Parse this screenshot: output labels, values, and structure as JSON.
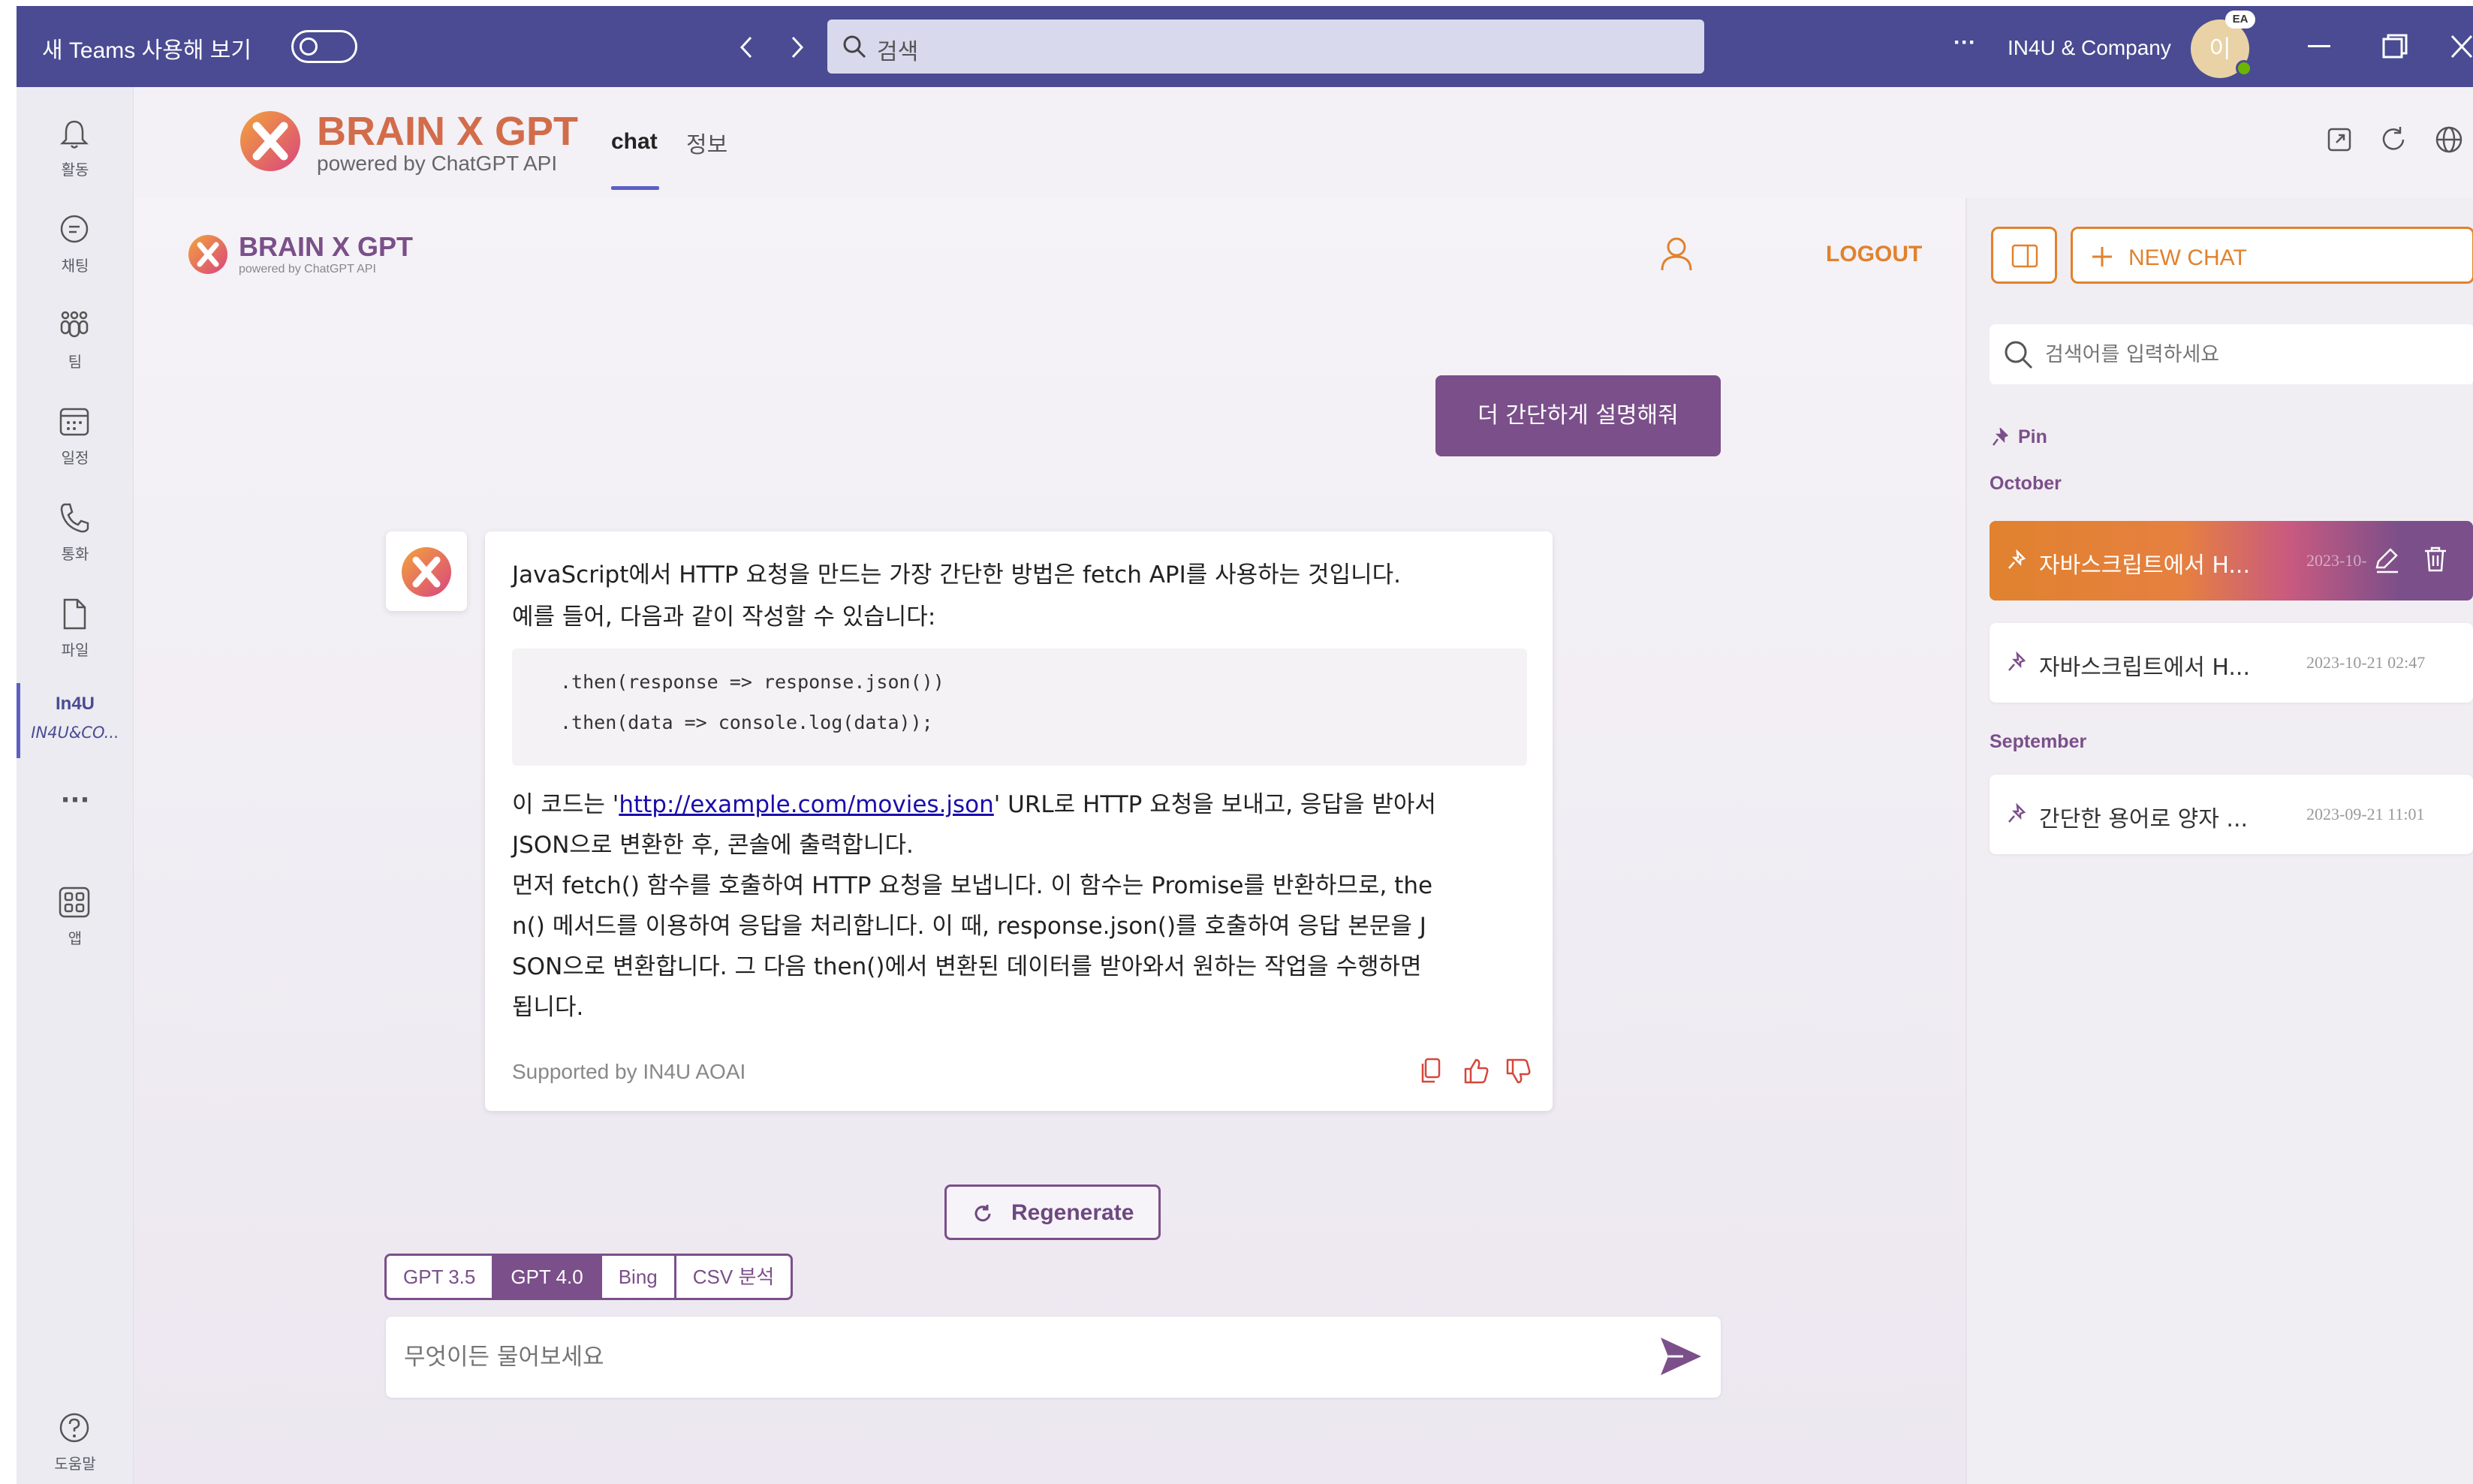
{
  "titlebar": {
    "new_teams_label": "새 Teams 사용해 보기",
    "search_placeholder": "검색",
    "more": "···",
    "org_name": "IN4U & Company",
    "avatar_initial": "이",
    "avatar_badge": "EA"
  },
  "rail": {
    "items": [
      {
        "label": "활동",
        "icon": "bell-icon"
      },
      {
        "label": "채팅",
        "icon": "chat-icon"
      },
      {
        "label": "팀",
        "icon": "teams-icon"
      },
      {
        "label": "일정",
        "icon": "calendar-icon"
      },
      {
        "label": "통화",
        "icon": "phone-icon"
      },
      {
        "label": "파일",
        "icon": "file-icon"
      },
      {
        "label": "IN4U&CO...",
        "logo": "In4U",
        "icon": "in4u-app-icon"
      },
      {
        "label": "···",
        "icon": "more-icon"
      },
      {
        "label": "앱",
        "icon": "apps-icon"
      },
      {
        "label": "도움말",
        "icon": "help-icon"
      }
    ]
  },
  "app_header": {
    "brand": "BRAIN X GPT",
    "brand_sub": "powered by ChatGPT API",
    "tabs": [
      {
        "label": "chat",
        "active": true
      },
      {
        "label": "정보",
        "active": false
      }
    ]
  },
  "chat": {
    "brand": "BRAIN X GPT",
    "brand_sub": "powered by ChatGPT API",
    "logout": "LOGOUT",
    "user_message": "더 간단하게 설명해줘",
    "answer": {
      "line1": "JavaScript에서 HTTP 요청을 만드는 가장 간단한 방법은 fetch API를 사용하는 것입니다.",
      "line2": "예를 들어, 다음과 같이 작성할 수 있습니다:",
      "code1": ".then(response => response.json())",
      "code2": ".then(data => console.log(data));",
      "line3_pre": "이 코드는 '",
      "line3_link": "http://example.com/movies.json",
      "line3_post": "' URL로 HTTP 요청을 보내고, 응답을 받아서",
      "line4": "JSON으로 변환한 후, 콘솔에 출력합니다.",
      "line5": "먼저 fetch() 함수를 호출하여 HTTP 요청을 보냅니다. 이 함수는 Promise를 반환하므로, the",
      "line6": "n() 메서드를 이용하여 응답을 처리합니다. 이 때, response.json()를 호출하여 응답 본문을 J",
      "line7": "SON으로 변환합니다. 그 다음 then()에서 변환된 데이터를 받아와서 원하는 작업을 수행하면",
      "line8": "됩니다.",
      "footer": "Supported by IN4U AOAI"
    },
    "regenerate": "Regenerate",
    "models": [
      {
        "label": "GPT 3.5",
        "active": false
      },
      {
        "label": "GPT 4.0",
        "active": true
      },
      {
        "label": "Bing",
        "active": false
      },
      {
        "label": "CSV 분석",
        "active": false
      }
    ],
    "input_placeholder": "무엇이든 물어보세요"
  },
  "sidebar": {
    "new_chat": "NEW CHAT",
    "search_placeholder": "검색어를 입력하세요",
    "pin_label": "Pin",
    "sections": [
      {
        "title": "October",
        "items": [
          {
            "title": "자바스크립트에서 H...",
            "date": "2023-10-...",
            "active": true
          },
          {
            "title": "자바스크립트에서 H...",
            "date": "2023-10-21 02:47",
            "active": false
          }
        ]
      },
      {
        "title": "September",
        "items": [
          {
            "title": "간단한 용어로 양자 ...",
            "date": "2023-09-21 11:01",
            "active": false
          }
        ]
      }
    ]
  },
  "colors": {
    "teams_bar": "#4a4b92",
    "accent": "#7b4f8a",
    "orange": "#e0822e"
  }
}
